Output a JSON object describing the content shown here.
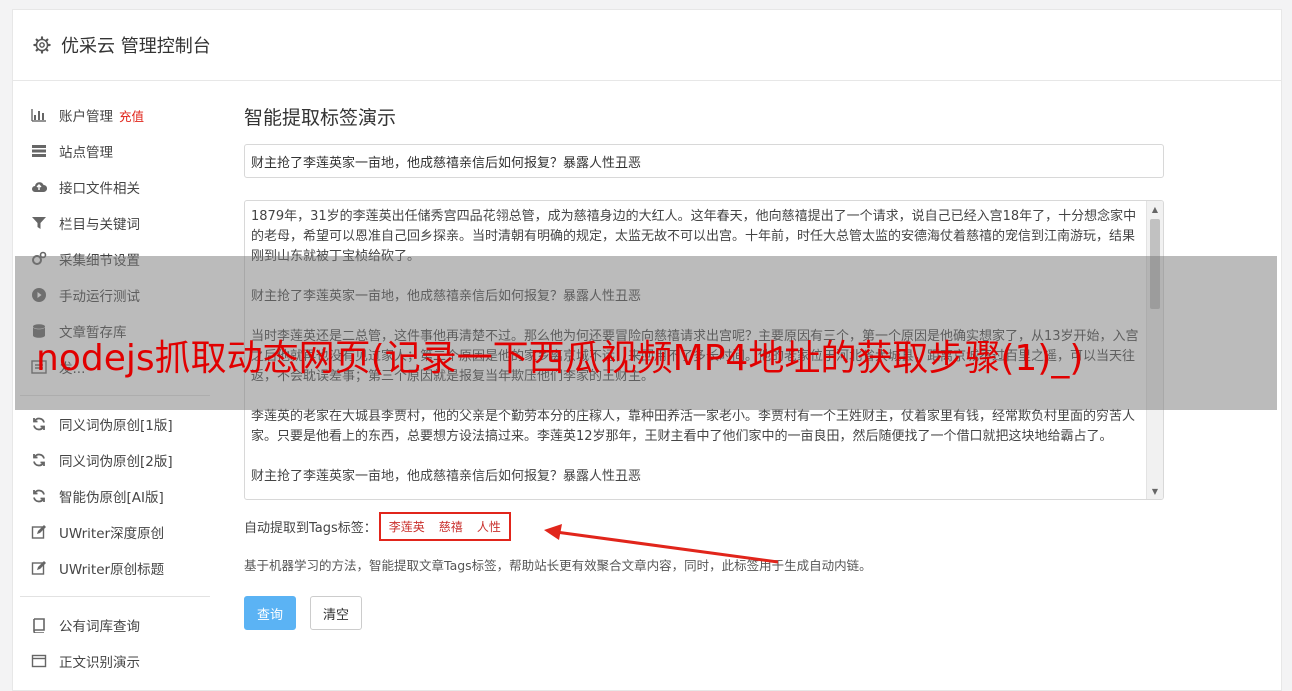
{
  "header": {
    "title": "优采云 管理控制台"
  },
  "sidebar": {
    "items": [
      {
        "label": "账户管理",
        "badge": "充值",
        "icon": "bar-chart-icon"
      },
      {
        "label": "站点管理",
        "icon": "server-icon"
      },
      {
        "label": "接口文件相关",
        "icon": "cloud-upload-icon"
      },
      {
        "label": "栏目与关键词",
        "icon": "filter-icon"
      },
      {
        "label": "采集细节设置",
        "icon": "gears-icon"
      },
      {
        "label": "手动运行测试",
        "icon": "play-icon"
      },
      {
        "label": "文章暂存库",
        "icon": "database-icon"
      },
      {
        "label": "发...",
        "icon": "list-icon"
      }
    ],
    "items2": [
      {
        "label": "同义词伪原创[1版]",
        "icon": "refresh-icon"
      },
      {
        "label": "同义词伪原创[2版]",
        "icon": "refresh-icon"
      },
      {
        "label": "智能伪原创[AI版]",
        "icon": "refresh-icon"
      },
      {
        "label": "UWriter深度原创",
        "icon": "edit-icon"
      },
      {
        "label": "UWriter原创标题",
        "icon": "edit-icon"
      }
    ],
    "items3": [
      {
        "label": "公有词库查询",
        "icon": "book-icon"
      },
      {
        "label": "正文识别演示",
        "icon": "window-icon"
      }
    ]
  },
  "main": {
    "heading": "智能提取标签演示",
    "title_value": "财主抢了李莲英家一亩地，他成慈禧亲信后如何报复？暴露人性丑恶",
    "content": [
      "1879年，31岁的李莲英出任储秀宫四品花翎总管，成为慈禧身边的大红人。这年春天，他向慈禧提出了一个请求，说自己已经入宫18年了，十分想念家中的老母，希望可以恩准自己回乡探亲。当时清朝有明确的规定，太监无故不可以出宫。十年前，时任大总管太监的安德海仗着慈禧的宠信到江南游玩，结果刚到山东就被丁宝桢给砍了。",
      "财主抢了李莲英家一亩地，他成慈禧亲信后如何报复？暴露人性丑恶",
      "当时李莲英还是二总管，这件事他再清楚不过。那么他为何还要冒险向慈禧请求出宫呢？主要原因有三个，第一个原因是他确实想家了，从13岁开始，入宫之后他就再也没有见过家人；第二个原因是他的家乡离京城不远，来回用不了多长时间。他的老家位于河北省大城县，距离京城不过百里之遥，可以当天往返，不会耽误差事；第三个原因就是报复当年欺压他们李家的王财主。",
      "李莲英的老家在大城县李贾村，他的父亲是个勤劳本分的庄稼人，靠种田养活一家老小。李贾村有一个王姓财主，仗着家里有钱，经常欺负村里面的穷苦人家。只要是他看上的东西，总要想方设法搞过来。李莲英12岁那年，王财主看中了他们家中的一亩良田，然后随便找了一个借口就把这块地给霸占了。",
      "财主抢了李莲英家一亩地，他成慈禧亲信后如何报复？暴露人性丑恶"
    ],
    "tags_label": "自动提取到Tags标签：",
    "tags": [
      "李莲英",
      "慈禧",
      "人性"
    ],
    "hint": "基于机器学习的方法，智能提取文章Tags标签，帮助站长更有效聚合文章内容，同时，此标签用于生成自动内链。",
    "query_button": "查询",
    "clear_button": "清空"
  },
  "overlay": {
    "text": "nodejs抓取动态网页(记录一下西瓜视频MP4地址的获取步骤(1)_)"
  },
  "colors": {
    "accent": "#5bb3f4",
    "tag_border": "#e1251b",
    "overlay_text": "#e10000",
    "badge": "#e1251b"
  }
}
